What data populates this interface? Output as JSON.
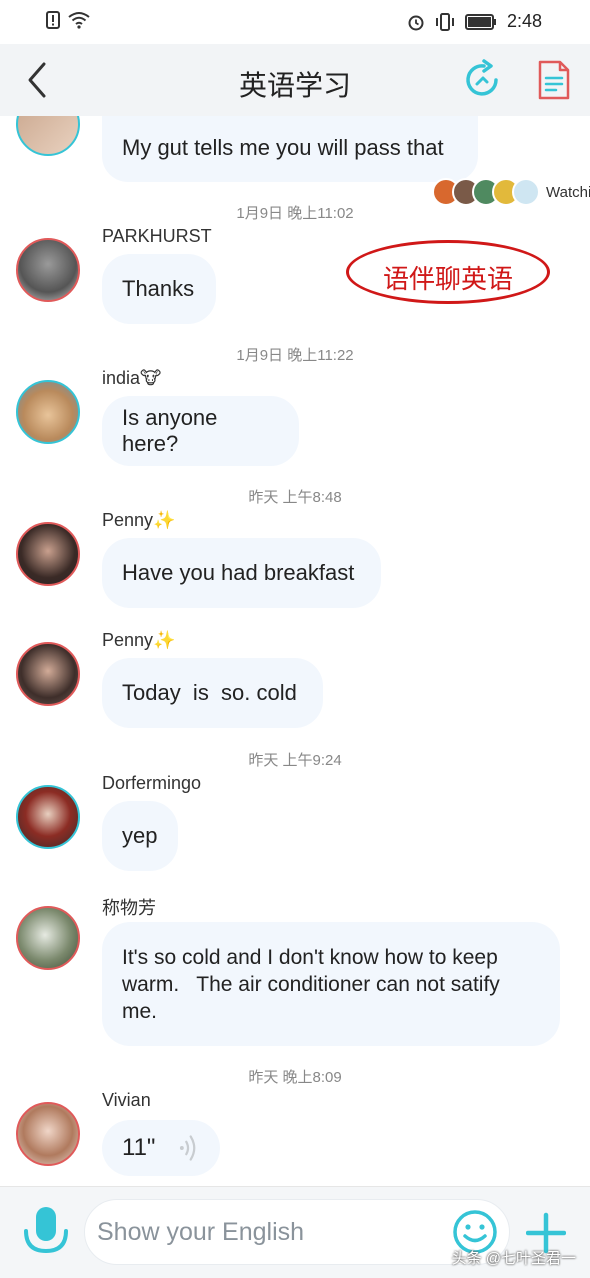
{
  "status_bar": {
    "time": "2:48"
  },
  "header": {
    "title": "英语学习"
  },
  "viewers": {
    "label": "Watching"
  },
  "stamp": {
    "text": "语伴聊英语"
  },
  "messages": {
    "m0": {
      "text": "My gut tells me you will pass that"
    },
    "t1": "1月9日 晚上11:02",
    "m1": {
      "sender": "PARKHURST",
      "text": "Thanks"
    },
    "t2": "1月9日 晚上11:22",
    "m2": {
      "sender": "india🐮",
      "text": "Is anyone here?"
    },
    "t3": "昨天 上午8:48",
    "m3": {
      "sender": "Penny✨",
      "text": "Have you had breakfast"
    },
    "m4": {
      "sender": "Penny✨",
      "text": "Today  is  so. cold"
    },
    "t4": "昨天 上午9:24",
    "m5": {
      "sender": "Dorfermingo",
      "text": "yep"
    },
    "m6": {
      "sender": "称物芳",
      "text": "It's so cold and I don't know how to keep warm.   The air conditioner can not satify me."
    },
    "t5": "昨天 晚上8:09",
    "m7": {
      "sender": "Vivian",
      "voice_duration": "11\""
    }
  },
  "input": {
    "placeholder": "Show your English"
  },
  "watermark": "头条 @七叶圣君一",
  "colors": {
    "accent": "#35c4d6",
    "avatar_border": "#e05a5a",
    "bubble_bg": "#f2f7fd",
    "stamp": "#d01818"
  }
}
